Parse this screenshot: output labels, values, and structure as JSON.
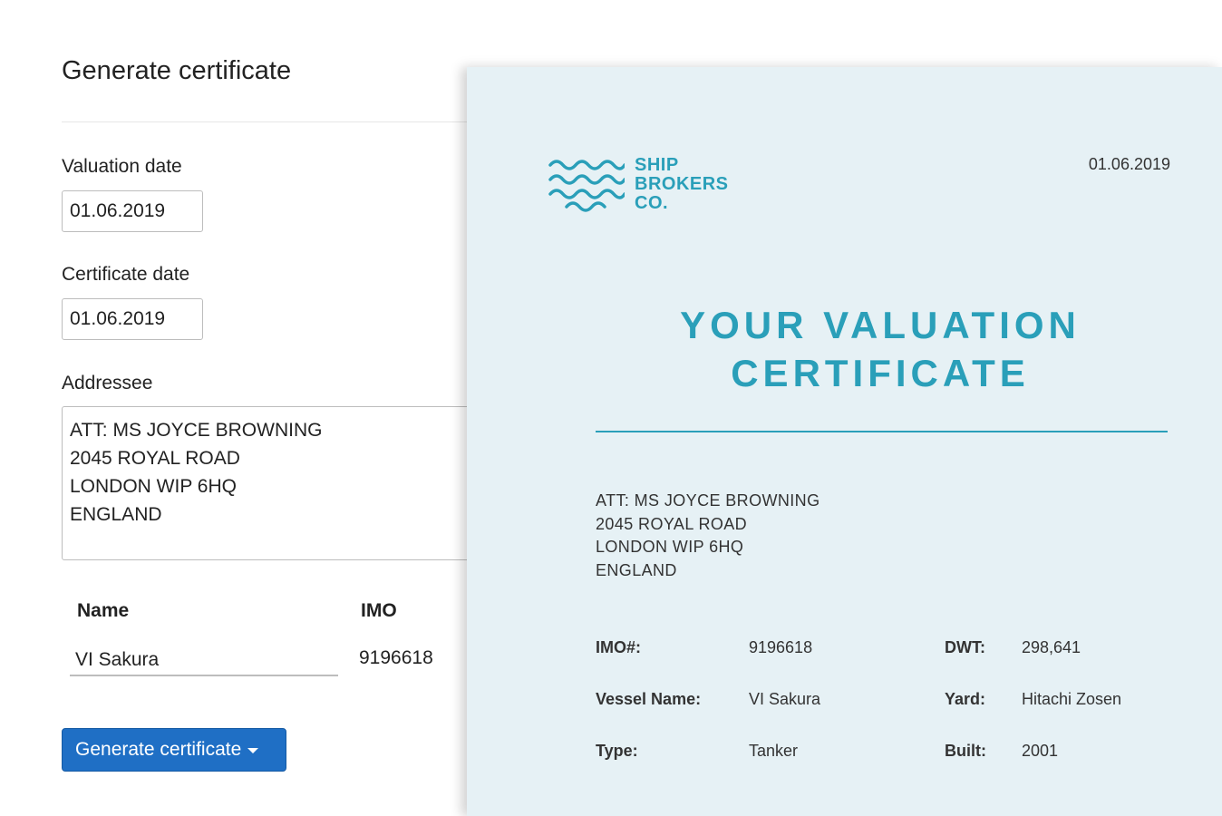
{
  "form": {
    "title": "Generate certificate",
    "valuation_date_label": "Valuation date",
    "valuation_date": "01.06.2019",
    "certificate_date_label": "Certificate date",
    "certificate_date": "01.06.2019",
    "addressee_label": "Addressee",
    "addressee_lines": [
      "ATT: MS JOYCE BROWNING",
      "2045 ROYAL ROAD",
      "LONDON WIP 6HQ",
      "ENGLAND"
    ],
    "name_header": "Name",
    "imo_header": "IMO",
    "vessel_name": "VI Sakura",
    "imo": "9196618",
    "generate_button": "Generate certificate"
  },
  "certificate": {
    "logo_lines": [
      "SHIP",
      "BROKERS",
      "CO."
    ],
    "date": "01.06.2019",
    "title_line1": "YOUR VALUATION",
    "title_line2": "CERTIFICATE",
    "addressee_lines": [
      "ATT: MS JOYCE BROWNING",
      "2045 ROYAL ROAD",
      "LONDON WIP 6HQ",
      "ENGLAND"
    ],
    "fields": {
      "imo_label": "IMO#:",
      "imo_value": "9196618",
      "vessel_label": "Vessel Name:",
      "vessel_value": "VI Sakura",
      "type_label": "Type:",
      "type_value": "Tanker",
      "dwt_label": "DWT:",
      "dwt_value": "298,641",
      "yard_label": "Yard:",
      "yard_value": "Hitachi Zosen",
      "built_label": "Built:",
      "built_value": "2001"
    },
    "accent_color": "#2a9fb9"
  },
  "colors": {
    "button": "#1f6fc5",
    "certificate_bg": "#e6f1f5"
  }
}
